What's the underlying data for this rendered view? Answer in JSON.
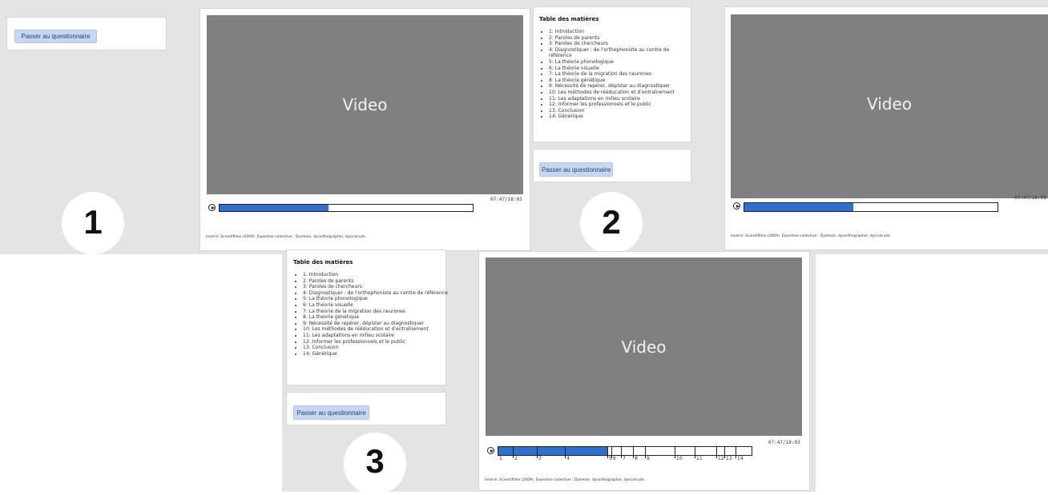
{
  "quiz_button_label": "Passer au questionnaire",
  "video_label": "Video",
  "time_display": "07:47/18:03",
  "progress_fraction": 0.431,
  "credit_text": "Inserm, Scientifilms (2009). Expertise collective : Dyslexie, dysorthographie, dyscalculie.",
  "toc": {
    "title": "Table des matières",
    "items": [
      "1: Introduction",
      "2: Paroles de parents",
      "3: Paroles de chercheurs",
      "4: Diagnostiquer : de l'orthophoniste au centre de référence",
      "5: La théorie phonologique",
      "6: La théorie visuelle",
      "7: La théorie de la migration des neurones",
      "8: La théorie génétique",
      "9: Nécessité de repérer, dépister au diagnostiquer",
      "10: Les méthodes de rééducation et d'entraînement",
      "11: Les adaptations en milieu scolaire",
      "12: Informer les professionnels et le public",
      "13: Conclusion",
      "14: Générique"
    ]
  },
  "chapter_markers": [
    "1",
    "2",
    "3",
    "4",
    "5",
    "6",
    "7",
    "8",
    "9",
    "10",
    "11",
    "12",
    "13",
    "14"
  ],
  "panel_numbers": [
    "1",
    "2",
    "3"
  ]
}
